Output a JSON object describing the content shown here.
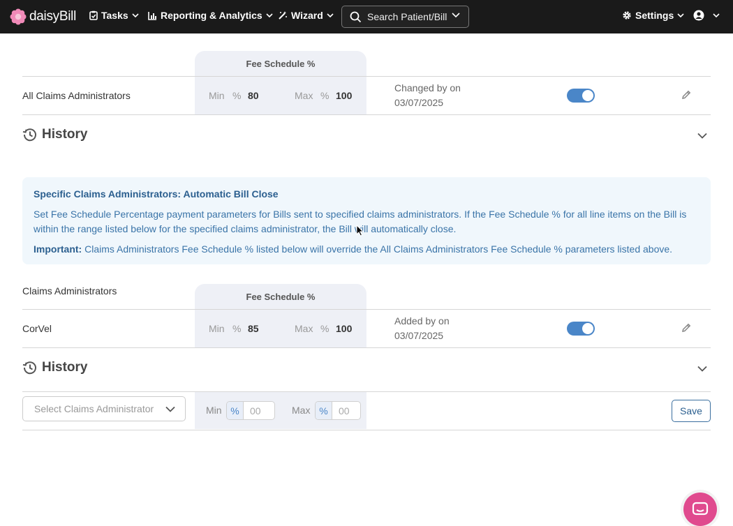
{
  "nav": {
    "brand": "daisyBill",
    "items": [
      {
        "label": "Tasks"
      },
      {
        "label": "Reporting & Analytics"
      },
      {
        "label": "Wizard"
      }
    ],
    "search_label": "Search Patient/Bill",
    "settings_label": "Settings"
  },
  "all_section": {
    "fee_header": "Fee Schedule %",
    "row": {
      "label": "All Claims Administrators",
      "min_label": "Min",
      "max_label": "Max",
      "pct_symbol": "%",
      "min_value": "80",
      "max_value": "100",
      "changed_line1": "Changed by on",
      "changed_line2": "03/07/2025",
      "enabled": true
    },
    "history_label": "History"
  },
  "info_box": {
    "title": "Specific Claims Administrators: Automatic Bill Close",
    "body": "Set Fee Schedule Percentage payment parameters for Bills sent to specified claims administrators. If the Fee Schedule % for all line items on the Bill is within the range listed below for the specified claims administrator, the Bill will automatically close.",
    "important_label": "Important:",
    "important_text": " Claims Administrators Fee Schedule % listed below will override the All Claims Administrators Fee Schedule % parameters listed above."
  },
  "specific_section": {
    "column_label": "Claims Administrators",
    "fee_header": "Fee Schedule %",
    "row": {
      "label": "CorVel",
      "min_label": "Min",
      "max_label": "Max",
      "pct_symbol": "%",
      "min_value": "85",
      "max_value": "100",
      "changed_line1": "Added by on",
      "changed_line2": "03/07/2025",
      "enabled": true
    },
    "history_label": "History",
    "add_form": {
      "select_placeholder": "Select Claims Administrator",
      "min_label": "Min",
      "max_label": "Max",
      "pct_symbol": "%",
      "min_placeholder": "00",
      "max_placeholder": "00",
      "save_label": "Save"
    }
  },
  "colors": {
    "nav_bg": "#1a1a1a",
    "accent": "#4a86c8",
    "info_bg": "#f0f7fc",
    "chat_button": "#e04a8e"
  }
}
